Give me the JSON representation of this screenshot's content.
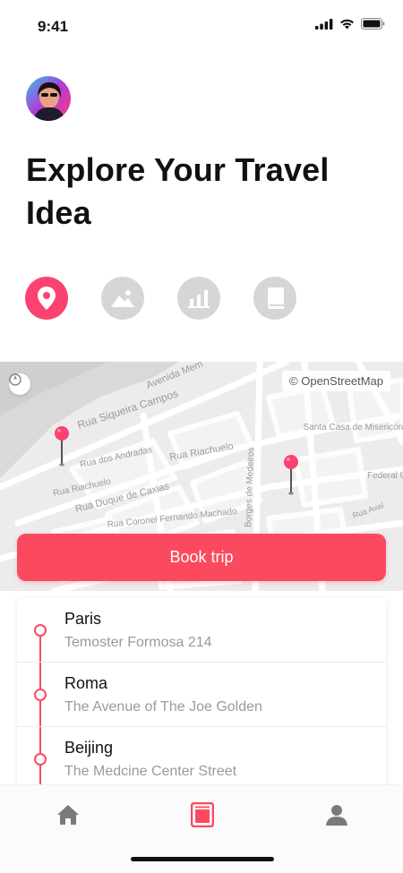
{
  "status_bar": {
    "time": "9:41"
  },
  "header": {
    "title": "Explore Your Travel Idea"
  },
  "categories": [
    {
      "icon": "location-pin-icon",
      "active": true
    },
    {
      "icon": "image-icon",
      "active": false
    },
    {
      "icon": "bar-chart-icon",
      "active": false
    },
    {
      "icon": "book-icon",
      "active": false
    }
  ],
  "map": {
    "attribution": "© OpenStreetMap",
    "streets": [
      "Avenida Mem",
      "Rua Siqueira Campos",
      "Rua dos Andradas",
      "Rua Riachuelo",
      "Rua Riachuelo",
      "Rua Duque de Caxias",
      "Rua Coronel Fernando Machado",
      "Borges de Medeiros",
      "Santa Casa de Misericórdia",
      "Federal University Grande do",
      "Rua Avaí"
    ]
  },
  "actions": {
    "book_trip_label": "Book trip"
  },
  "trips": [
    {
      "city": "Paris",
      "address": "Temoster Formosa 214"
    },
    {
      "city": "Roma",
      "address": "The Avenue of The Joe Golden"
    },
    {
      "city": "Beijing",
      "address": "The Medcine Center Street"
    }
  ],
  "colors": {
    "accent": "#fb4a60",
    "active_icon": "#fb4270",
    "inactive_icon": "#d6d6d6",
    "nav_icon": "#7a7a7a"
  },
  "bottom_nav": [
    {
      "icon": "home-icon",
      "active": false
    },
    {
      "icon": "calendar-icon",
      "active": true
    },
    {
      "icon": "profile-icon",
      "active": false
    }
  ]
}
